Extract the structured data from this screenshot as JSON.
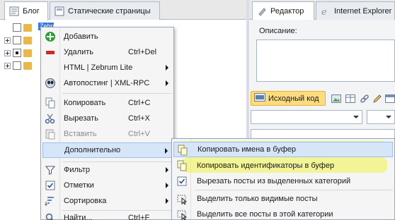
{
  "tabs_left": [
    {
      "label": "Блог",
      "icon": "blog-icon",
      "active": true
    },
    {
      "label": "Статические страницы",
      "icon": "page-icon",
      "active": false
    }
  ],
  "tabs_right": [
    {
      "label": "Редактор",
      "icon": "pen-icon",
      "active": true
    },
    {
      "label": "Internet Explorer",
      "icon": "ie-icon",
      "active": false
    }
  ],
  "tree": {
    "selected_label": "Zebrum"
  },
  "right_panel": {
    "description_label": "Описание:",
    "source_button": "Исходный код"
  },
  "context_menu": {
    "items": [
      {
        "label": "Добавить",
        "icon": "add-icon",
        "shortcut": "",
        "enabled": true,
        "submenu": false
      },
      {
        "label": "Удалить",
        "icon": "delete-icon",
        "shortcut": "Ctrl+Del",
        "enabled": true,
        "submenu": false
      },
      {
        "label": "HTML | Zebrum Lite",
        "icon": "",
        "shortcut": "",
        "enabled": true,
        "submenu": true
      },
      {
        "label": "Автопостинг | XML-RPC",
        "icon": "autopost-icon",
        "shortcut": "",
        "enabled": true,
        "submenu": true
      },
      {
        "label": "Копировать",
        "icon": "copy-icon",
        "shortcut": "Ctrl+C",
        "enabled": true,
        "submenu": false
      },
      {
        "label": "Вырезать",
        "icon": "scissors-icon",
        "shortcut": "Ctrl+X",
        "enabled": true,
        "submenu": false
      },
      {
        "label": "Вставить",
        "icon": "paste-icon",
        "shortcut": "Ctrl+V",
        "enabled": false,
        "submenu": false
      },
      {
        "label": "Дополнительно",
        "icon": "",
        "shortcut": "",
        "enabled": true,
        "submenu": true
      },
      {
        "label": "Фильтр",
        "icon": "filter-icon",
        "shortcut": "",
        "enabled": true,
        "submenu": true
      },
      {
        "label": "Отметки",
        "icon": "checkmark-icon",
        "shortcut": "",
        "enabled": true,
        "submenu": true
      },
      {
        "label": "Сортировка",
        "icon": "sort-icon",
        "shortcut": "",
        "enabled": true,
        "submenu": true
      },
      {
        "label": "Найти...",
        "icon": "search-icon",
        "shortcut": "Ctrl+F",
        "enabled": true,
        "submenu": false
      }
    ]
  },
  "submenu": {
    "items": [
      {
        "label": "Копировать имена в буфер",
        "icon": "copy-names-icon",
        "highlighted": true
      },
      {
        "label": "Копировать идентификаторы в буфер",
        "icon": "copy-ids-icon",
        "highlighted": true
      },
      {
        "label": "Вырезать посты из выделенных категорий",
        "icon": "cut-posts-icon",
        "highlighted": false
      },
      {
        "label": "Выделить только видимые посты",
        "icon": "select-visible-icon",
        "highlighted": false
      },
      {
        "label": "Выделить все посты в этой категории",
        "icon": "select-all-icon",
        "highlighted": false
      }
    ]
  },
  "colors": {
    "menu_hover": "#d6e6f8",
    "highlighter": "#f0f246",
    "source_button": "#fcdc7c",
    "tree_selection": "#3875d7"
  }
}
